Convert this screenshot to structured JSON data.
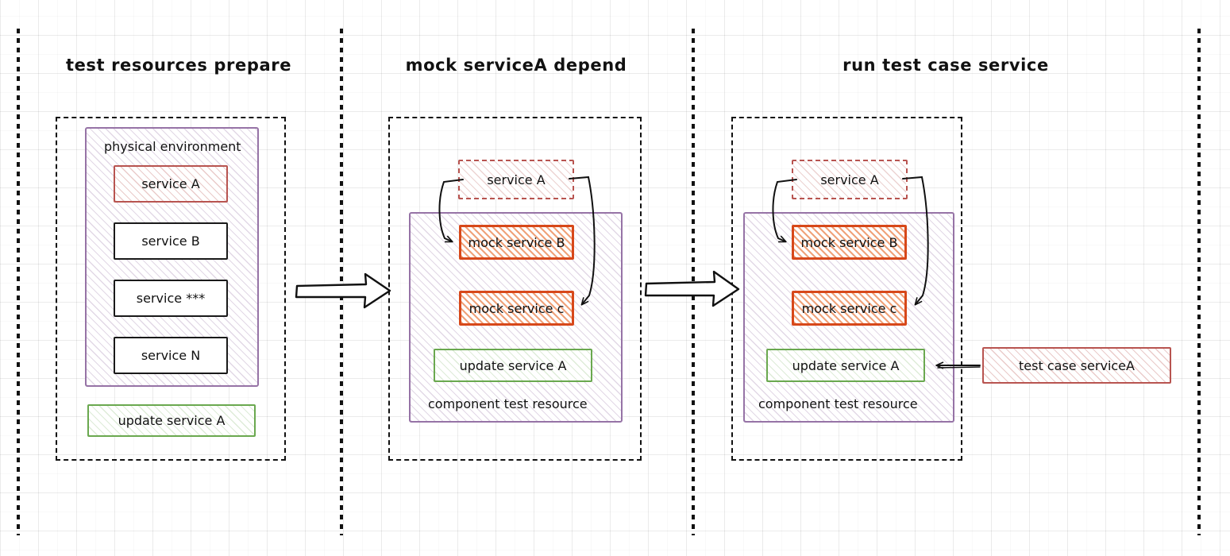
{
  "lanes": [
    {
      "id": "lane-1",
      "title": "test resources prepare"
    },
    {
      "id": "lane-2",
      "title": "mock serviceA depend"
    },
    {
      "id": "lane-3",
      "title": "run test case service"
    }
  ],
  "lane1": {
    "container_label": "physical environment",
    "services": [
      {
        "label": "service A",
        "style": "red-solid"
      },
      {
        "label": "service B",
        "style": "plain"
      },
      {
        "label": "service ***",
        "style": "plain"
      },
      {
        "label": "service N",
        "style": "plain"
      }
    ],
    "update_service": "update service A"
  },
  "lane2": {
    "mock_service_a": "service A",
    "container_label": "component test resource",
    "mocks": [
      {
        "label": "mock service B"
      },
      {
        "label": "mock service c"
      }
    ],
    "update_service": "update service A"
  },
  "lane3": {
    "mock_service_a": "service A",
    "container_label": "component test resource",
    "mocks": [
      {
        "label": "mock service B"
      },
      {
        "label": "mock service c"
      }
    ],
    "update_service": "update service A",
    "test_case": "test case serviceA"
  },
  "connectors": {
    "flow_1_label": "",
    "flow_2_label": "",
    "mock_b_arrow": "service A depends on mock service B",
    "mock_c_arrow": "service A depends on mock service c",
    "test_case_arrow": "test case serviceA invokes update service A"
  },
  "colors": {
    "red": "#b85450",
    "orange": "#d7481a",
    "green": "#6aa84f",
    "purple": "#9673a6",
    "black": "#111111",
    "grid": "#e8e8e8"
  }
}
